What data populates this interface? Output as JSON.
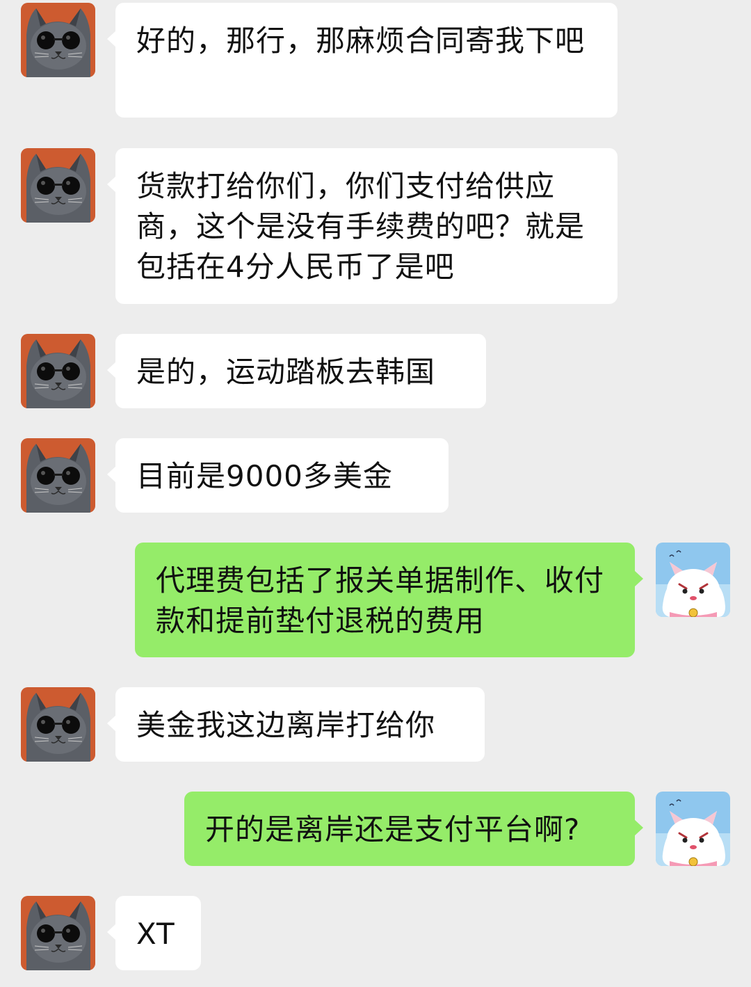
{
  "colors": {
    "background": "#ededed",
    "incoming_bubble": "#ffffff",
    "outgoing_bubble": "#95ec69",
    "text": "#111111"
  },
  "avatars": {
    "contact": "cat-with-sunglasses-avatar",
    "self": "cartoon-cat-avatar"
  },
  "messages": [
    {
      "sender": "contact",
      "text": "好的，那行，那麻烦合同寄我下吧"
    },
    {
      "sender": "contact",
      "text": "货款打给你们，你们支付给供应商，这个是没有手续费的吧？就是包括在4分人民币了是吧"
    },
    {
      "sender": "contact",
      "text": "是的，运动踏板去韩国"
    },
    {
      "sender": "contact",
      "text": "目前是9000多美金"
    },
    {
      "sender": "self",
      "text": "代理费包括了报关单据制作、收付款和提前垫付退税的费用"
    },
    {
      "sender": "contact",
      "text": "美金我这边离岸打给你"
    },
    {
      "sender": "self",
      "text": "开的是离岸还是支付平台啊?"
    },
    {
      "sender": "contact",
      "text": "XT"
    }
  ]
}
